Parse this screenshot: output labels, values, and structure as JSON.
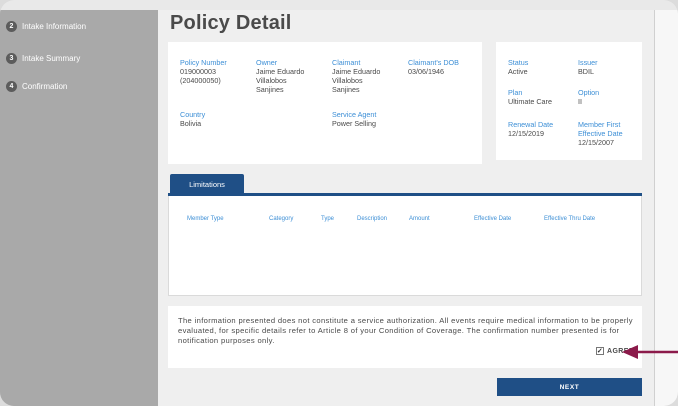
{
  "sidebar": {
    "steps": [
      {
        "number": "2",
        "label": "Intake Information"
      },
      {
        "number": "3",
        "label": "Intake Summary"
      },
      {
        "number": "4",
        "label": "Confirmation"
      }
    ]
  },
  "page_title": "Policy Detail",
  "policy": {
    "policy_number": {
      "label": "Policy Number",
      "value": "019000003\n(204000050)"
    },
    "owner": {
      "label": "Owner",
      "value": "Jaime Eduardo\nVillalobos\nSanjines"
    },
    "claimant": {
      "label": "Claimant",
      "value": "Jaime Eduardo\nVillalobos\nSanjines"
    },
    "claimant_dob": {
      "label": "Claimant's DOB",
      "value": "03/06/1946"
    },
    "country": {
      "label": "Country",
      "value": "Bolivia"
    },
    "service_agent": {
      "label": "Service Agent",
      "value": "Power Selling"
    }
  },
  "status_card": {
    "status": {
      "label": "Status",
      "value": "Active"
    },
    "issuer": {
      "label": "Issuer",
      "value": "BDIL"
    },
    "plan": {
      "label": "Plan",
      "value": "Ultimate Care"
    },
    "option": {
      "label": "Option",
      "value": "II"
    },
    "renewal_date": {
      "label": "Renewal Date",
      "value": "12/15/2019"
    },
    "member_first_effective_date": {
      "label": "Member First\nEffective Date",
      "value": "12/15/2007"
    }
  },
  "limitations": {
    "tab_label": "Limitations",
    "columns": [
      "Member Type",
      "Category",
      "Type",
      "Description",
      "Amount",
      "Effective Date",
      "Effective Thru Date"
    ]
  },
  "notice": {
    "text": "The information presented does not constitute a service authorization. All events require medical information to be properly evaluated, for specific details refer to Article 8 of your Condition of Coverage. The confirmation number presented is for notification purposes only.",
    "agree_label": "AGREE",
    "agree_checked": true
  },
  "next_label": "NEXT",
  "colors": {
    "accent": "#1f4f86",
    "label_blue": "#3d8fd6",
    "arrow": "#8b1a4a"
  }
}
